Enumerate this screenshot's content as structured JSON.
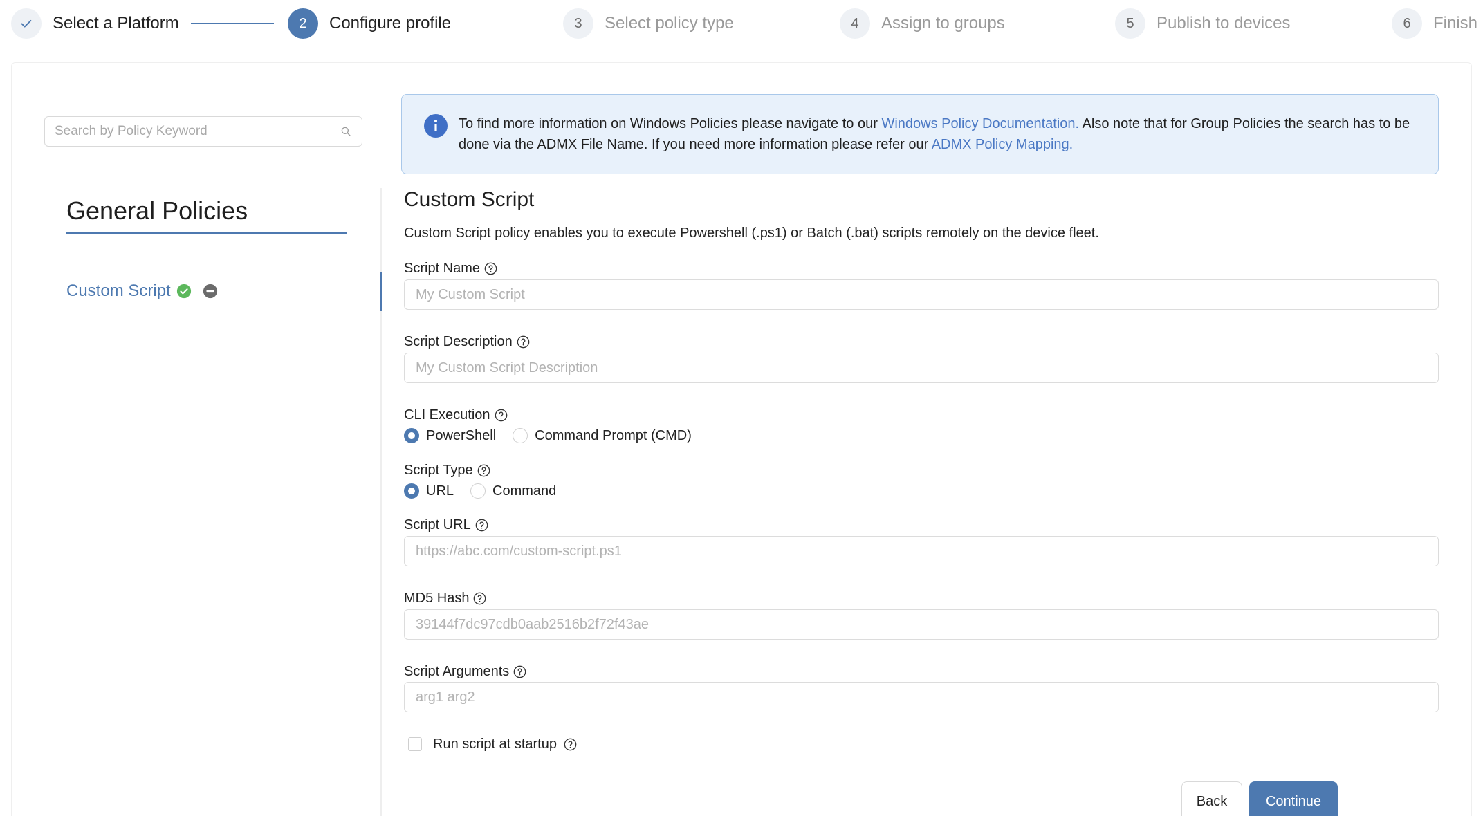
{
  "stepper": {
    "steps": [
      {
        "number": "",
        "label": "Select a Platform",
        "status": "done"
      },
      {
        "number": "2",
        "label": "Configure profile",
        "status": "active"
      },
      {
        "number": "3",
        "label": "Select policy type",
        "status": "pending"
      },
      {
        "number": "4",
        "label": "Assign to groups",
        "status": "pending"
      },
      {
        "number": "5",
        "label": "Publish to devices",
        "status": "pending"
      },
      {
        "number": "6",
        "label": "Finish",
        "status": "pending"
      }
    ]
  },
  "sidebar": {
    "search_placeholder": "Search by Policy Keyword",
    "search_value": "",
    "title": "General Policies",
    "items": [
      {
        "label": "Custom Script",
        "status_icon": "check-circle-icon",
        "action_icon": "remove-icon"
      }
    ]
  },
  "info_banner": {
    "icon": "info-icon",
    "text_1": "To find more information on Windows Policies please navigate to our ",
    "link_1": "Windows Policy Documentation.",
    "text_2": " Also note that for Group Policies the search has to be done via the ADMX File Name. If you need more information please refer our ",
    "link_2": "ADMX Policy Mapping."
  },
  "form": {
    "title": "Custom Script",
    "description": "Custom Script policy enables you to execute Powershell (.ps1) or Batch (.bat) scripts remotely on the device fleet.",
    "script_name": {
      "label": "Script Name",
      "placeholder": "My Custom Script",
      "value": ""
    },
    "script_description": {
      "label": "Script Description",
      "placeholder": "My Custom Script Description",
      "value": ""
    },
    "cli_execution": {
      "label": "CLI Execution",
      "options": [
        "PowerShell",
        "Command Prompt (CMD)"
      ],
      "selected": "PowerShell"
    },
    "script_type": {
      "label": "Script Type",
      "options": [
        "URL",
        "Command"
      ],
      "selected": "URL"
    },
    "script_url": {
      "label": "Script URL",
      "placeholder": "https://abc.com/custom-script.ps1",
      "value": ""
    },
    "md5_hash": {
      "label": "MD5 Hash",
      "placeholder": "39144f7dc97cdb0aab2516b2f72f43ae",
      "value": ""
    },
    "script_arguments": {
      "label": "Script Arguments",
      "placeholder": "arg1 arg2",
      "value": ""
    },
    "run_at_startup": {
      "label": "Run script at startup",
      "checked": false
    }
  },
  "actions": {
    "back_label": "Back",
    "continue_label": "Continue"
  },
  "colors": {
    "accent": "#4d79b0",
    "link": "#4a78c4",
    "success": "#5cb85c",
    "info_bg": "#e8f1fb",
    "info_border": "#a9c8ea"
  }
}
